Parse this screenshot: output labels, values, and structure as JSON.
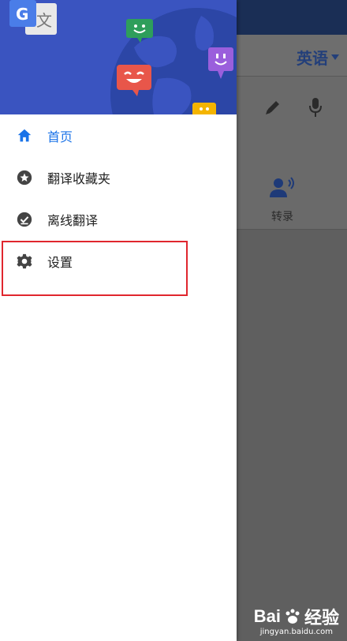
{
  "background": {
    "language_selector": "英语",
    "transcribe_label": "转录"
  },
  "drawer": {
    "menu": [
      {
        "id": "home",
        "label": "首页",
        "icon": "home-icon",
        "active": true
      },
      {
        "id": "favorites",
        "label": "翻译收藏夹",
        "icon": "star-icon",
        "active": false
      },
      {
        "id": "offline",
        "label": "离线翻译",
        "icon": "offline-check-icon",
        "active": false
      },
      {
        "id": "settings",
        "label": "设置",
        "icon": "gear-icon",
        "active": false
      }
    ]
  },
  "watermark": {
    "brand_left": "Bai",
    "brand_right": "经验",
    "url": "jingyan.baidu.com"
  },
  "colors": {
    "accent_blue": "#1a73e8",
    "hero_blue": "#3a54c0",
    "highlight_red": "#e0262e",
    "overlay_gray": "#5f5f5f"
  }
}
